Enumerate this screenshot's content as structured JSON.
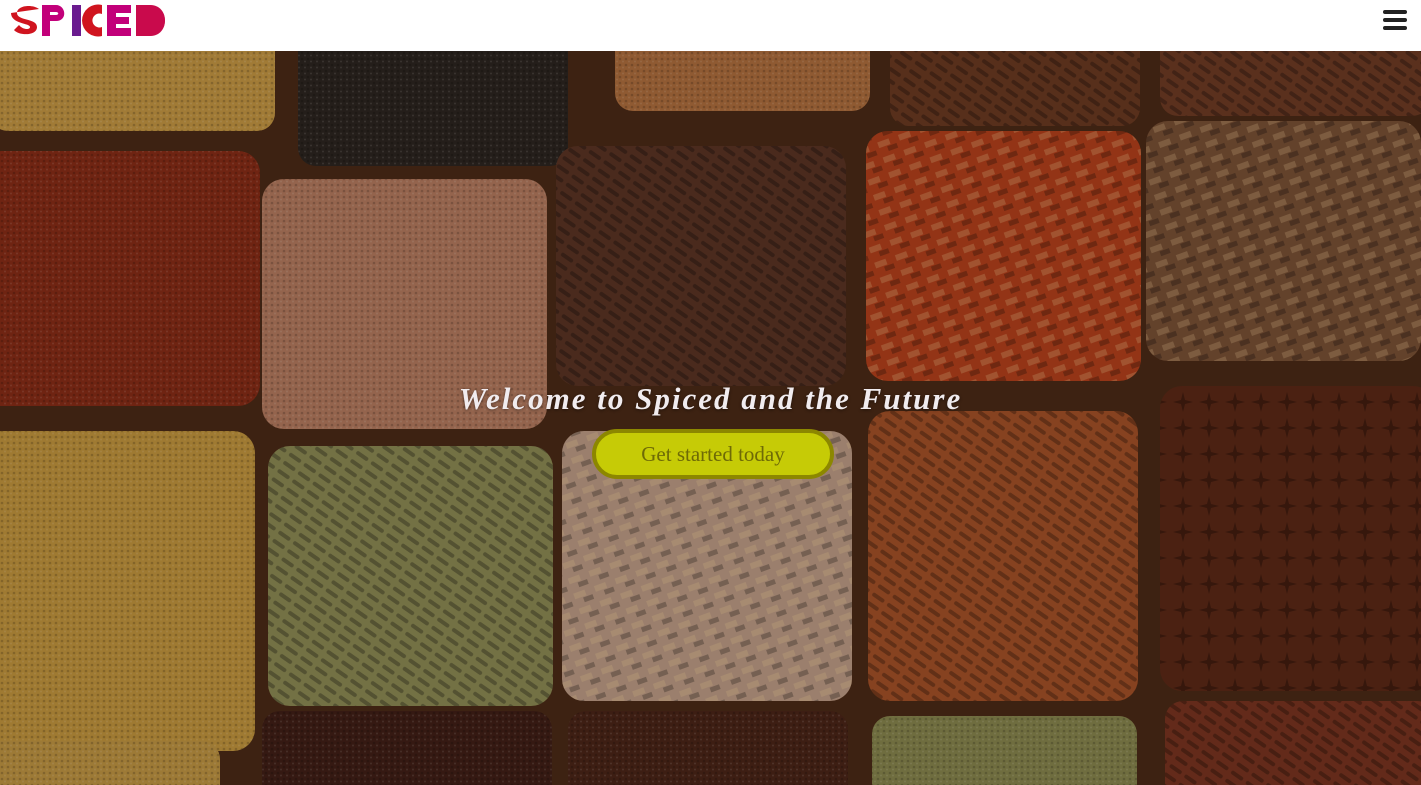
{
  "header": {
    "logo_text": "SPICED",
    "menu_icon": "hamburger-menu-icon"
  },
  "hero": {
    "headline": "Welcome to Spiced and the Future",
    "cta_label": "Get started today"
  },
  "colors": {
    "cta_background": "#c6cb06",
    "cta_border": "#8c8700",
    "cta_text": "#6e6a06",
    "headline_text": "#f1ecef",
    "logo_red": "#d0141f",
    "logo_magenta": "#c2007a",
    "logo_purple": "#6a1b8f"
  }
}
